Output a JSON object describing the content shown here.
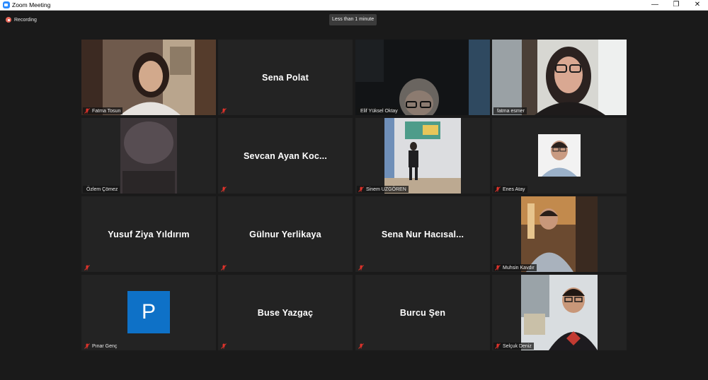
{
  "window": {
    "title": "Zoom Meeting",
    "minimize": "—",
    "maximize": "❐",
    "close": "✕"
  },
  "recording": {
    "label": "Recording"
  },
  "timer": {
    "label": "Less than 1 minute"
  },
  "participants": [
    {
      "name": "Fatma Tosun",
      "muted": true,
      "video": true
    },
    {
      "name": "Sena Polat",
      "muted": true,
      "video": false
    },
    {
      "name": "Elif Yüksel Oktay",
      "muted": false,
      "video": true
    },
    {
      "name": "fatma esmer",
      "muted": false,
      "video": true,
      "speaking": true
    },
    {
      "name": "Özlem Çömez",
      "muted": false,
      "video": true
    },
    {
      "name": "Sevcan Ayan Koc...",
      "muted": true,
      "video": false
    },
    {
      "name": "Sinem UZGÖREN",
      "muted": true,
      "video": true
    },
    {
      "name": "Enes Atay",
      "muted": true,
      "video": true
    },
    {
      "name": "Yusuf Ziya Yıldırım",
      "muted": true,
      "video": false
    },
    {
      "name": "Gülnur Yerlikaya",
      "muted": true,
      "video": false
    },
    {
      "name": "Sena Nur Hacısal...",
      "muted": true,
      "video": false
    },
    {
      "name": "Muhsin Kavdır",
      "muted": true,
      "video": true
    },
    {
      "name": "Pınar Genç",
      "muted": true,
      "video": false,
      "avatar_letter": "P"
    },
    {
      "name": "Buse Yazgaç",
      "muted": true,
      "video": false
    },
    {
      "name": "Burcu Şen",
      "muted": true,
      "video": false
    },
    {
      "name": "Selçuk Deniz",
      "muted": true,
      "video": true
    }
  ],
  "colors": {
    "background": "#1a1a1a",
    "tile": "#232323",
    "active_border": "#a8ff2f",
    "muted_icon": "#e0332b",
    "avatar": "#0e71c7"
  }
}
